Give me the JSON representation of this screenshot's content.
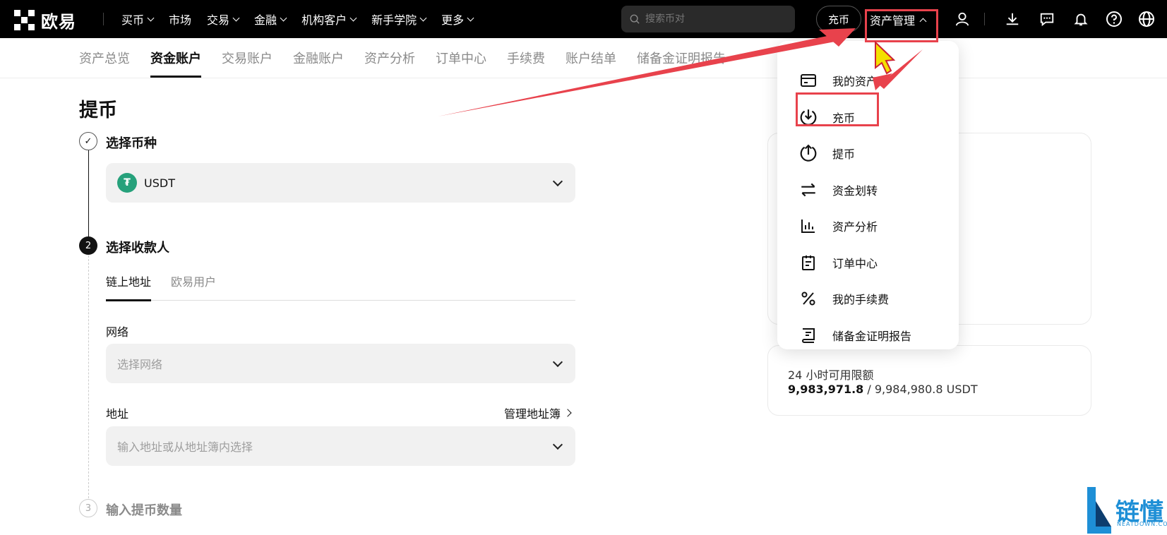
{
  "brand": {
    "name": "欧易"
  },
  "topnav": {
    "items": [
      {
        "label": "买币",
        "dropdown": true
      },
      {
        "label": "市场",
        "dropdown": false
      },
      {
        "label": "交易",
        "dropdown": true
      },
      {
        "label": "金融",
        "dropdown": true
      },
      {
        "label": "机构客户",
        "dropdown": true
      },
      {
        "label": "新手学院",
        "dropdown": true
      },
      {
        "label": "更多",
        "dropdown": true
      }
    ],
    "search_placeholder": "搜索币对",
    "deposit_label": "充币",
    "asset_mgmt_label": "资产管理"
  },
  "subnav": {
    "tabs": [
      "资产总览",
      "资金账户",
      "交易账户",
      "金融账户",
      "资产分析",
      "订单中心",
      "手续费",
      "账户结单",
      "储备金证明报告"
    ],
    "active_index": 1
  },
  "page": {
    "title": "提币"
  },
  "steps": [
    {
      "number": "✓",
      "title": "选择币种"
    },
    {
      "number": "2",
      "title": "选择收款人"
    },
    {
      "number": "3",
      "title": "输入提币数量"
    }
  ],
  "coin": {
    "symbol": "USDT"
  },
  "recipient_tabs": {
    "items": [
      "链上地址",
      "欧易用户"
    ],
    "active_index": 0
  },
  "network": {
    "label": "网络",
    "placeholder": "选择网络"
  },
  "address": {
    "label": "地址",
    "placeholder": "输入地址或从地址簿内选择",
    "book_link": "管理地址簿"
  },
  "limit_card": {
    "title": "24 小时可用限额",
    "used": "9,983,971.8",
    "total": " / 9,984,980.8 USDT"
  },
  "dropdown": {
    "items": [
      {
        "label": "我的资产",
        "icon": "card-icon"
      },
      {
        "label": "充币",
        "icon": "download-circle-icon"
      },
      {
        "label": "提币",
        "icon": "upload-circle-icon"
      },
      {
        "label": "资金划转",
        "icon": "transfer-arrows-icon"
      },
      {
        "label": "资产分析",
        "icon": "bar-chart-icon"
      },
      {
        "label": "订单中心",
        "icon": "clipboard-icon"
      },
      {
        "label": "我的手续费",
        "icon": "percent-icon"
      },
      {
        "label": "储备金证明报告",
        "icon": "report-icon"
      }
    ]
  },
  "watermark": {
    "text": "链懂",
    "sub": "NEATDOWN.COM"
  },
  "colors": {
    "accent": "#e8424c",
    "usdt": "#26a17b",
    "watermark": "#1e8fd6"
  }
}
